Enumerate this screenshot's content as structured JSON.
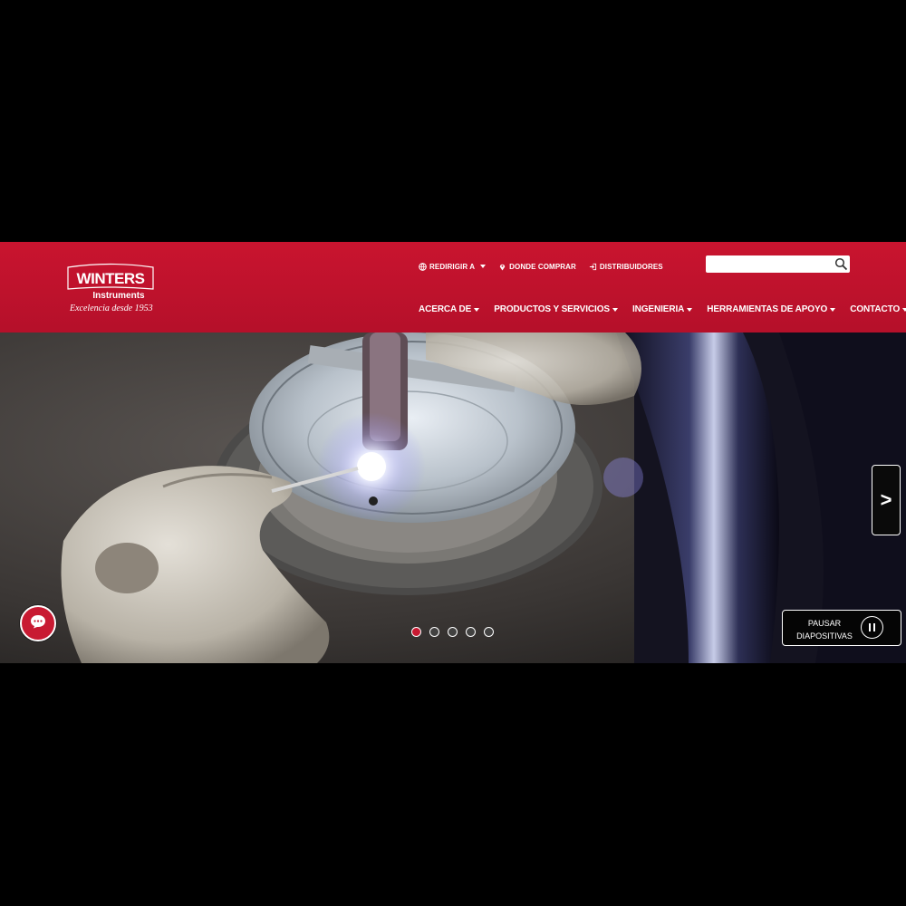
{
  "brand": {
    "logo_text": "WINTERS",
    "logo_sub": "Instruments",
    "tagline": "Excelencia desde 1953"
  },
  "utility_nav": [
    {
      "label": "REDIRIGIR A",
      "icon": "globe-icon",
      "dropdown": true
    },
    {
      "label": "DONDE COMPRAR",
      "icon": "location-pin-icon",
      "dropdown": false
    },
    {
      "label": "DISTRIBUIDORES",
      "icon": "login-icon",
      "dropdown": false
    }
  ],
  "search": {
    "placeholder": "",
    "value": "",
    "icon": "search-icon"
  },
  "main_nav": [
    {
      "label": "ACERCA DE"
    },
    {
      "label": "PRODUCTOS Y SERVICIOS"
    },
    {
      "label": "INGENIERIA"
    },
    {
      "label": "HERRAMIENTAS DE APOYO"
    },
    {
      "label": "CONTACTO"
    }
  ],
  "hero": {
    "next_label": ">",
    "slide_count": 5,
    "active_slide": 1,
    "pause": {
      "line1": "PAUSAR",
      "line2": "DIAPOSITIVAS",
      "icon": "pause-icon"
    },
    "chat_icon": "chat-icon"
  },
  "colors": {
    "brand_red": "#c8132f",
    "active_dot": "#c81a32"
  }
}
